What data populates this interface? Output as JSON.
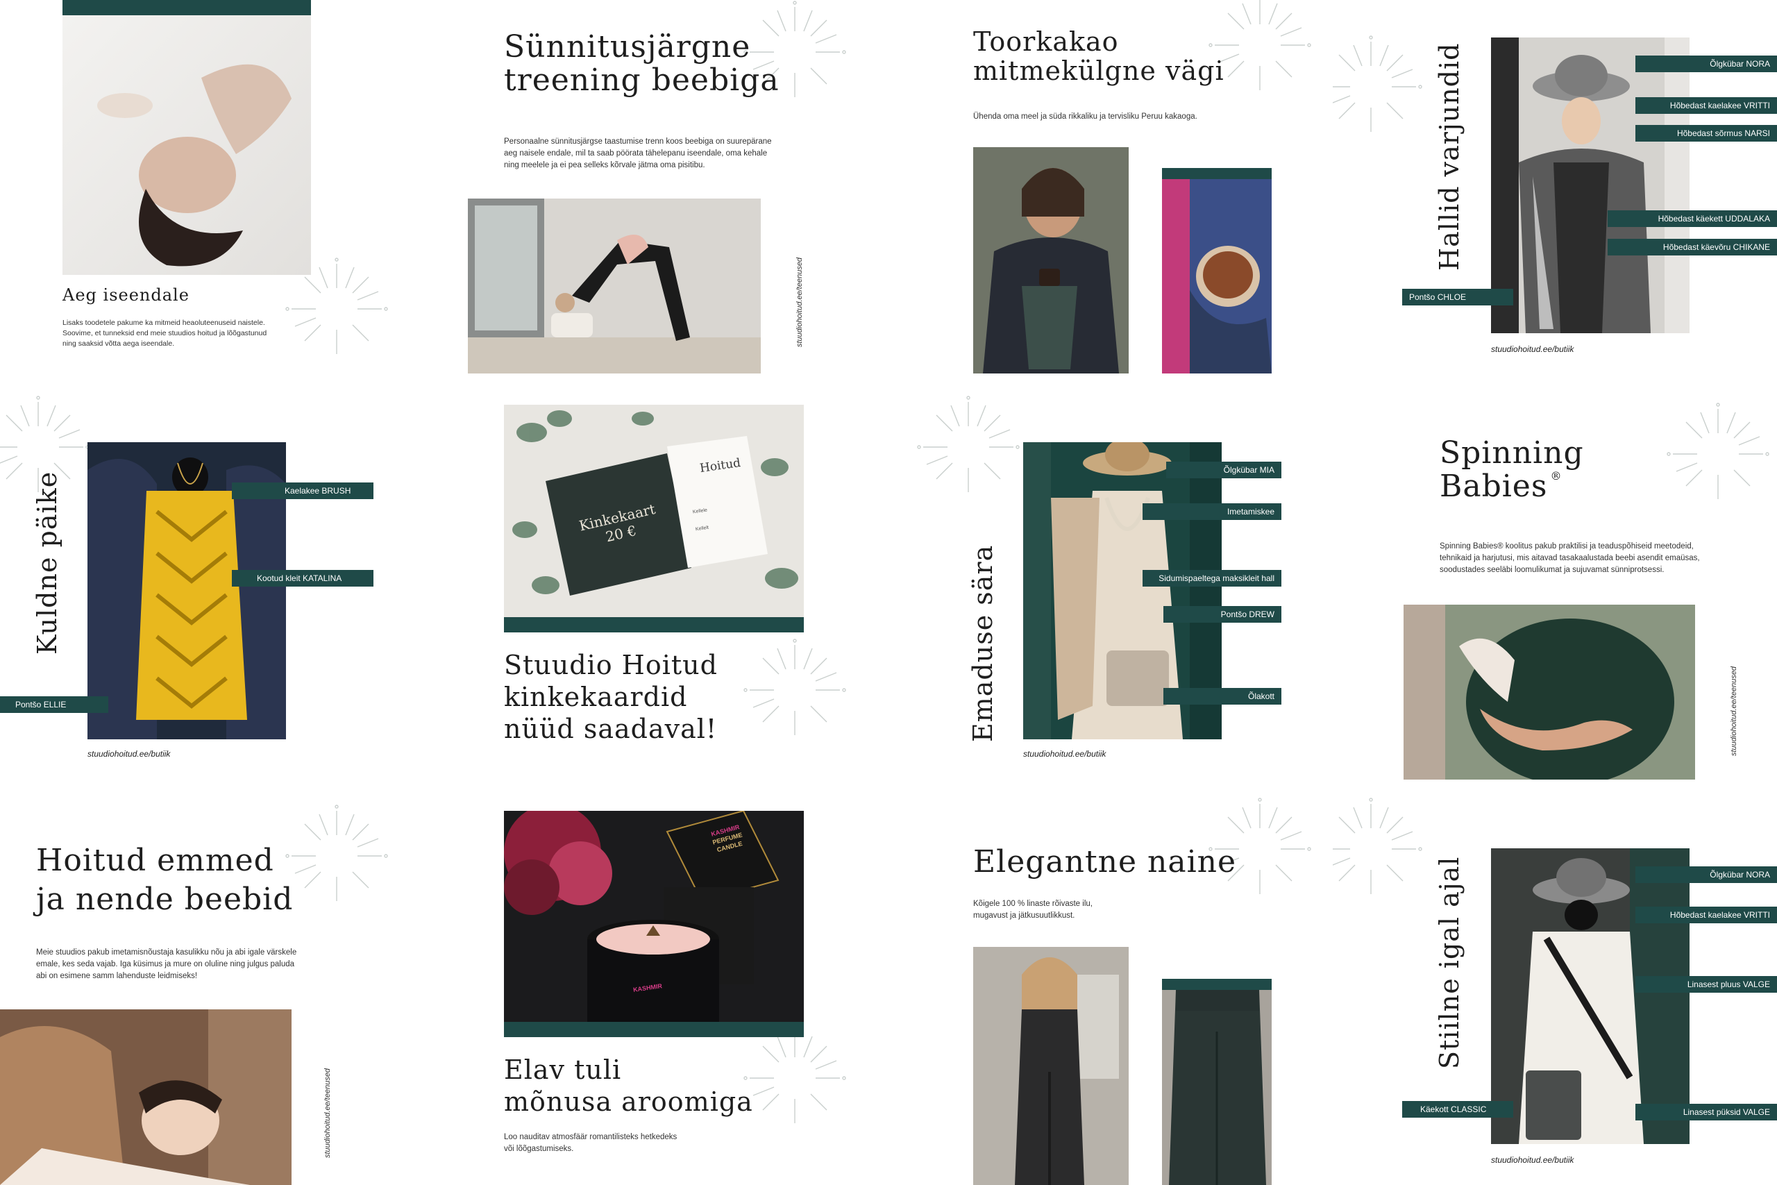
{
  "colors": {
    "accent": "#1f4a48",
    "background": "#ffffff",
    "text": "#1e1e1e"
  },
  "tiles": {
    "t1": {
      "title": "Aeg iseendale",
      "text": "Lisaks toodetele pakume ka mitmeid heaoluteenuseid naistele.\nSoovime, et tunneksid end meie stuudios hoitud ja lõõgastunud\nning saaksid võtta aega iseendale."
    },
    "t2": {
      "title": "Sünnitusjärgne\ntreening beebiga",
      "text": "Personaalne sünnitusjärgse taastumise trenn koos beebiga on suurepärane\naeg naisele endale, mil ta saab pöörata tähelepanu iseendale, oma kehale\nning meelele ja ei pea selleks kõrvale jätma oma pisitibu.",
      "url": "stuudiohoitud.ee/teenused"
    },
    "t3": {
      "title": "Toorkakao\nmitmekülgne vägi",
      "text": "Ühenda oma meel ja süda rikkaliku ja tervisliku Peruu kakaoga."
    },
    "t4": {
      "title": "Hallid varjundid",
      "url": "stuudiohoitud.ee/butiik",
      "tags": [
        "Õlgkübar NORA",
        "Hõbedast kaelakee VRITTI",
        "Hõbedast sõrmus NARSI",
        "Hõbedast käekett UDDALAKA",
        "Hõbedast käevõru CHIKANE",
        "Pontšo CHLOE"
      ]
    },
    "t5": {
      "title": "Kuldne päike",
      "url": "stuudiohoitud.ee/butiik",
      "tags": [
        "Kaelakee BRUSH",
        "Kootud kleit KATALINA",
        "Pontšo ELLIE"
      ]
    },
    "t6": {
      "title": "Stuudio Hoitud\nkinkekaardid\nnüüd saadaval!",
      "card": {
        "label": "Kinkekaart\n20 €",
        "logo": "Hoitud",
        "field1": "Kellele",
        "field2": "Kellelt"
      }
    },
    "t7": {
      "title": "Emaduse sära",
      "url": "stuudiohoitud.ee/butiik",
      "tags": [
        "Õlgkübar MIA",
        "Imetamiskee",
        "Sidumispaeltega maksikleit hall",
        "Pontšo DREW",
        "Õlakott"
      ]
    },
    "t8": {
      "title": "Spinning\nBabies",
      "title_mark": "®",
      "text": "Spinning Babies® koolitus pakub praktilisi ja teaduspõhiseid meetodeid,\ntehnikaid ja harjutusi, mis aitavad tasakaalustada beebi asendit emaüsas,\nsoodustades seeläbi loomulikumat ja sujuvamat sünniprotsessi.",
      "url": "stuudiohoitud.ee/teenused"
    },
    "t9": {
      "title": "Hoitud emmed\nja nende beebid",
      "text": "Meie stuudios pakub imetamisnõustaja kasulikku nõu ja abi igale värskele\nemale, kes seda vajab. Iga küsimus ja mure on oluline ning julgus paluda\nabi on esimene samm lahenduste leidmiseks!",
      "url": "stuudiohoitud.ee/teenused"
    },
    "t10": {
      "title": "Elav tuli\nmõnusa aroomiga",
      "text": "Loo nauditav atmosfäär romantilisteks hetkedeks\nvõi lõõgastumiseks.",
      "candle": {
        "brand": "KASHMIR",
        "line1": "PERFUME",
        "line2": "CANDLE"
      }
    },
    "t11": {
      "title": "Elegantne naine",
      "text": "Kõigele 100 % linaste rõivaste ilu,\nmugavust ja jätkusuutlikkust."
    },
    "t12": {
      "title": "Stiilne igal ajal",
      "url": "stuudiohoitud.ee/butiik",
      "tags": [
        "Õlgkübar NORA",
        "Hõbedast kaelakee VRITTI",
        "Linasest pluus VALGE",
        "Käekott CLASSIC",
        "Linasest püksid VALGE"
      ]
    }
  }
}
